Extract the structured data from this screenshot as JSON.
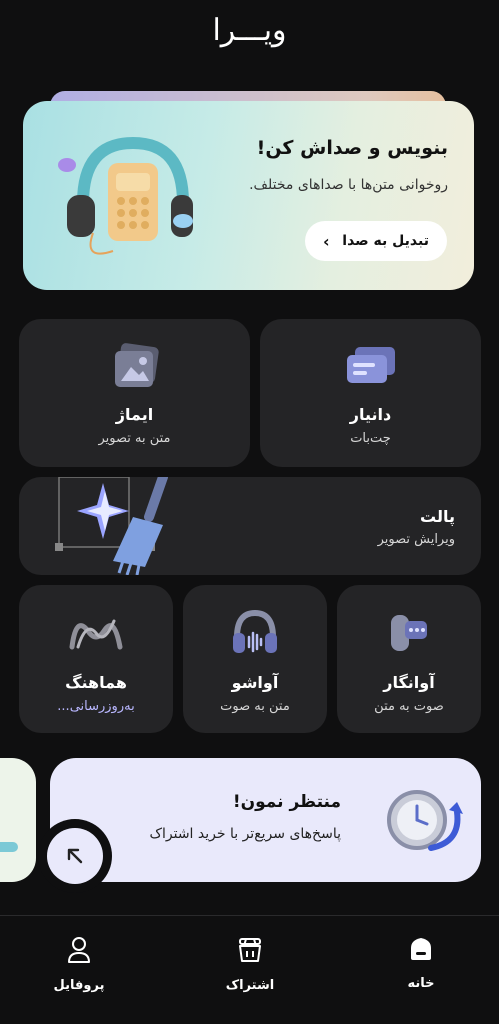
{
  "app": {
    "logo": "ویـــرا"
  },
  "hero": {
    "title": "بنویس و صداش کن!",
    "subtitle": "روخوانی متن‌ها با صداهای مختلف.",
    "button_label": "تبدیل به صدا",
    "button_icon": "chevron-left-icon"
  },
  "tools": {
    "danyar": {
      "title": "دانیار",
      "subtitle": "چت‌بات",
      "icon": "chat-bubbles-icon"
    },
    "imaj": {
      "title": "ایماژ",
      "subtitle": "متن به تصویر",
      "icon": "image-icon"
    },
    "palet": {
      "title": "پالت",
      "subtitle": "ویرایش تصویر",
      "icon": "brush-icon"
    },
    "avangar": {
      "title": "آوانگار",
      "subtitle": "صوت به متن",
      "icon": "microphone-icon"
    },
    "avasho": {
      "title": "آواشو",
      "subtitle": "متن به صوت",
      "icon": "headphones-icon"
    },
    "hamahang": {
      "title": "هماهنگ",
      "subtitle": "به‌روزرسانی...",
      "icon": "wave-logo-icon",
      "subtitle_color": "#b9b7ff"
    }
  },
  "subscription_banner": {
    "title": "منتظر نمون!",
    "text": "پاسخ‌های سریع‌تر با خرید اشتراک",
    "icon": "clock-refresh-icon",
    "arrow_icon": "arrow-up-left-icon"
  },
  "nav": {
    "home": {
      "label": "خانه",
      "icon": "home-icon"
    },
    "subscription": {
      "label": "اشتراک",
      "icon": "basket-icon"
    },
    "profile": {
      "label": "پروفایل",
      "icon": "user-icon"
    }
  }
}
